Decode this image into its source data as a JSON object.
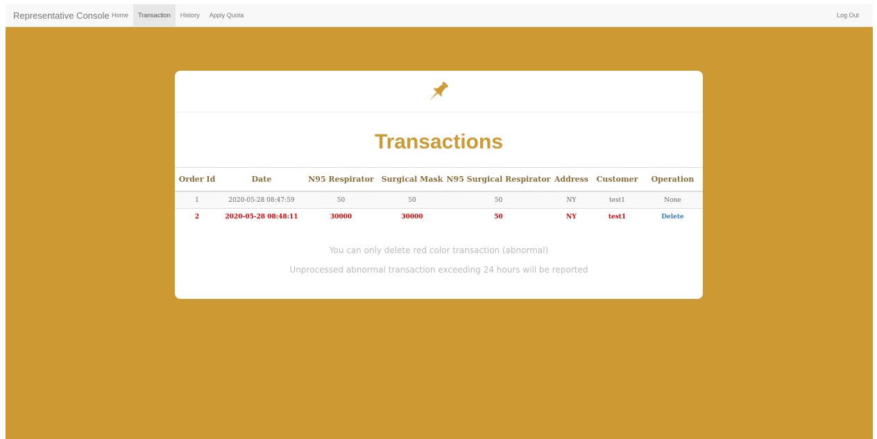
{
  "navbar": {
    "brand": "Representative Console",
    "links": [
      {
        "label": "Home",
        "active": false
      },
      {
        "label": "Transaction",
        "active": true
      },
      {
        "label": "History",
        "active": false
      },
      {
        "label": "Apply Quota",
        "active": false
      }
    ],
    "logout": "Log Out"
  },
  "colors": {
    "background": "#cc9933",
    "accent": "#cc9933",
    "abnormal_text": "#dd0000",
    "link": "#337ab7"
  },
  "card": {
    "icon": "pushpin-icon",
    "title": "Transactions"
  },
  "table": {
    "headers": [
      "Order Id",
      "Date",
      "N95 Respirator",
      "Surgical Mask",
      "N95 Surgical Respirator",
      "Address",
      "Customer",
      "Operation"
    ],
    "rows": [
      {
        "status": "normal",
        "cells": [
          "1",
          "2020-05-28 08:47:59",
          "50",
          "50",
          "50",
          "NY",
          "test1",
          "None"
        ]
      },
      {
        "status": "abnormal",
        "cells": [
          "2",
          "2020-05-28 08:48:11",
          "30000",
          "30000",
          "50",
          "NY",
          "test1",
          "Delete"
        ]
      }
    ]
  },
  "notes": {
    "line1": "You can only delete red color transaction (abnormal)",
    "line2": "Unprocessed abnormal transaction exceeding 24 hours will be reported"
  }
}
